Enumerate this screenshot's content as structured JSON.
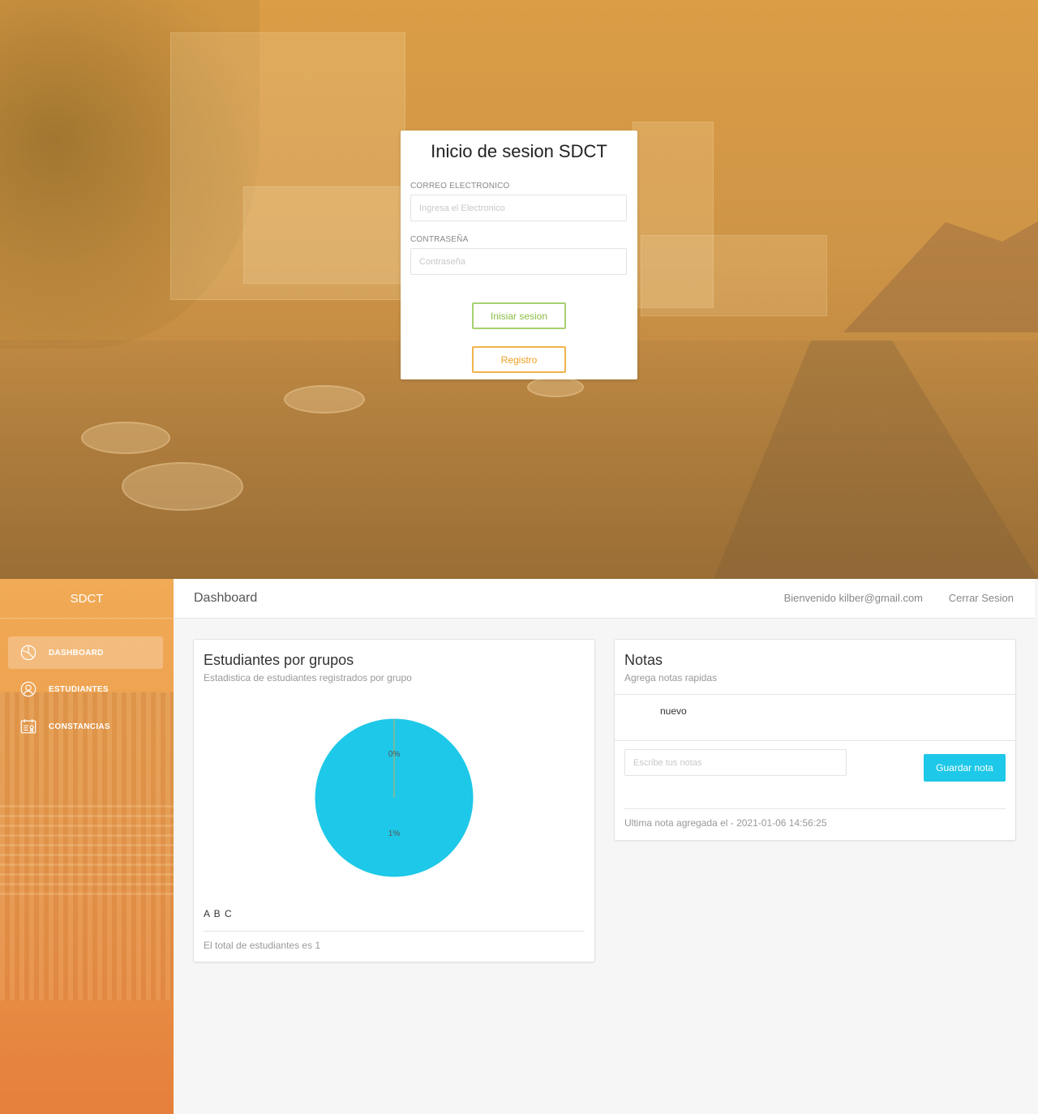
{
  "login": {
    "title": "Inicio de sesion SDCT",
    "email_label": "CORREO ELECTRONICO",
    "email_placeholder": "Ingresa el Electronico",
    "email_value": "",
    "password_label": "CONTRASEÑA",
    "password_placeholder": "Contraseña",
    "password_value": "",
    "login_button": "Inisiar sesion",
    "register_button": "Registro",
    "colors": {
      "login_accent": "#8bbd44",
      "register_accent": "#ee9f22",
      "overlay": "#e0a046"
    }
  },
  "sidebar": {
    "brand": "SDCT",
    "items": [
      {
        "label": "DASHBOARD",
        "icon": "pie-chart-icon",
        "active": true
      },
      {
        "label": "ESTUDIANTES",
        "icon": "user-group-icon",
        "active": false
      },
      {
        "label": "CONSTANCIAS",
        "icon": "certificate-icon",
        "active": false
      }
    ]
  },
  "header": {
    "title": "Dashboard",
    "welcome": "Bienvenido kilber@gmail.com",
    "logout": "Cerrar Sesion"
  },
  "groups_card": {
    "title": "Estudiantes por grupos",
    "subtitle": "Estadistica de estudiantes registrados por grupo",
    "legend": "A B C",
    "footer": "El total de estudiantes es 1"
  },
  "chart_data": {
    "type": "pie",
    "title": "Estudiantes por grupos",
    "categories": [
      "A",
      "B",
      "C"
    ],
    "values": [
      0,
      1,
      0
    ],
    "labels": [
      "0%",
      "1%"
    ],
    "colors": [
      "#f0a030",
      "#1ec8e8",
      "#ffffff"
    ]
  },
  "notes_card": {
    "title": "Notas",
    "subtitle": "Agrega notas rapidas",
    "notes": [
      "nuevo"
    ],
    "input_placeholder": "Escribe tus notas",
    "input_value": "",
    "save_button": "Guardar nota",
    "footer": "Ultima nota agregada el - 2021-01-06 14:56:25",
    "colors": {
      "save_button": "#1ec8e8"
    }
  }
}
